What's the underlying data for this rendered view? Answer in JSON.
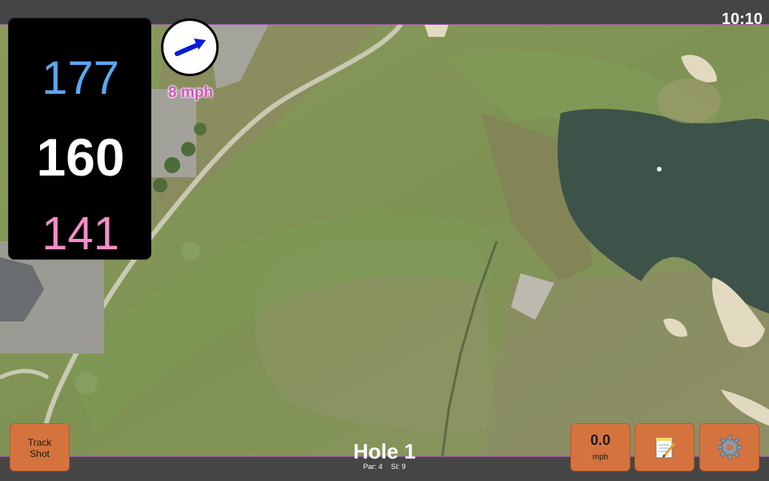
{
  "status": {
    "time": "10:10"
  },
  "distances": {
    "back": "177",
    "middle": "160",
    "front": "141"
  },
  "wind": {
    "speed": "8 mph",
    "icon": "wind-arrow-icon"
  },
  "hole": {
    "title": "Hole 1",
    "par_label": "Par: 4",
    "si_label": "SI: 9"
  },
  "buttons": {
    "track_shot_line1": "Track",
    "track_shot_line2": "Shot",
    "speed_value": "0.0",
    "speed_unit": "mph",
    "notes_icon": "notepad-icon",
    "settings_icon": "gear-icon"
  },
  "colors": {
    "back": "#5aa7f0",
    "middle": "#ffffff",
    "front": "#f28fc6",
    "button": "#d4733d",
    "wind_text": "#d64fc4"
  }
}
